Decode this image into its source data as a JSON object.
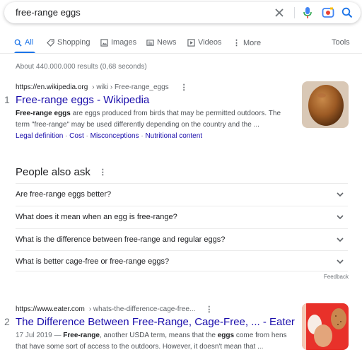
{
  "search": {
    "query": "free-range eggs"
  },
  "tabs": [
    {
      "label": "All",
      "icon": "search-icon",
      "active": true
    },
    {
      "label": "Shopping",
      "icon": "tag-icon"
    },
    {
      "label": "Images",
      "icon": "image-icon"
    },
    {
      "label": "News",
      "icon": "newspaper-icon"
    },
    {
      "label": "Videos",
      "icon": "play-icon"
    },
    {
      "label": "More",
      "icon": "more-vert-icon"
    }
  ],
  "tools_label": "Tools",
  "stats": "About 440.000.000 results (0,68 seconds)",
  "results": [
    {
      "rank": "1",
      "url_domain": "https://en.wikipedia.org",
      "url_path": "› wiki › Free-range_eggs",
      "title": "Free-range eggs - Wikipedia",
      "snippet_bold": "Free-range eggs",
      "snippet_rest": " are eggs produced from birds that may be permitted outdoors. The term \"free-range\" may be used differently depending on the country and the ...",
      "sitelinks": [
        "Legal definition",
        "Cost",
        "Misconceptions",
        "Nutritional content"
      ]
    },
    {
      "rank": "2",
      "url_domain": "https://www.eater.com",
      "url_path": "› whats-the-difference-cage-free...",
      "title": "The Difference Between Free-Range, Cage-Free, ... - Eater",
      "date": "17 Jul 2019",
      "dash": " — ",
      "bold1": "Free-range",
      "mid": ", another USDA term, means that the ",
      "bold2": "eggs",
      "rest": " come from hens that have some sort of access to the outdoors. However, it doesn't mean that ..."
    }
  ],
  "people_also_ask": {
    "title": "People also ask",
    "questions": [
      "Are free-range eggs better?",
      "What does it mean when an egg is free-range?",
      "What is the difference between free-range and regular eggs?",
      "What is better cage-free or free-range eggs?"
    ],
    "feedback": "Feedback"
  },
  "colors": {
    "accent": "#1a73e8",
    "link": "#1a0dab",
    "text": "#202124",
    "muted": "#70757a"
  }
}
